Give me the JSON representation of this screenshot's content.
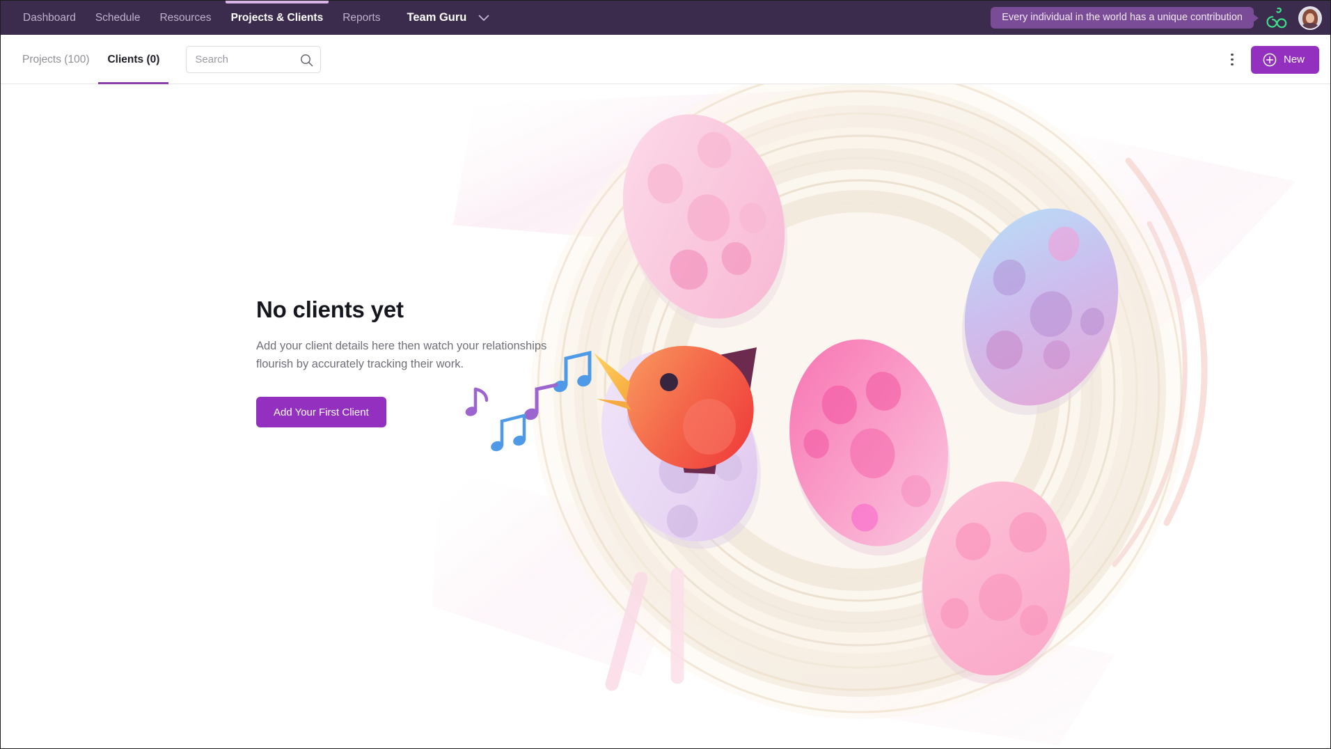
{
  "topnav": {
    "items": [
      {
        "label": "Dashboard",
        "active": false
      },
      {
        "label": "Schedule",
        "active": false
      },
      {
        "label": "Resources",
        "active": false
      },
      {
        "label": "Projects & Clients",
        "active": true
      },
      {
        "label": "Reports",
        "active": false
      }
    ],
    "team_name": "Team Guru",
    "team_chevron_icon": "chevron-down-icon",
    "tooltip_text": "Every individual in the world has a unique contribution",
    "logo_icon": "infinity-mascot-icon",
    "logo_color": "#3fe08a",
    "avatar_icon": "user-avatar",
    "background_color": "#3b2b4d",
    "active_indicator_color": "#d7b3e8"
  },
  "toolbar": {
    "tabs": [
      {
        "label": "Projects (100)",
        "active": false
      },
      {
        "label": "Clients (0)",
        "active": true
      }
    ],
    "search": {
      "placeholder": "Search",
      "value": "",
      "icon": "search-icon"
    },
    "more_menu_icon": "kebab-menu-icon",
    "new_button": {
      "label": "New",
      "icon": "plus-circle-icon",
      "color": "#9430bf"
    },
    "active_tab_underline_color": "#8b3fa8"
  },
  "empty_state": {
    "title": "No clients yet",
    "description": "Add your client details here then watch your relationships flourish by accurately tracking their work.",
    "cta_label": "Add Your First Client",
    "cta_color": "#9430bf"
  },
  "illustration": {
    "name": "bird-nest-with-eggs-illustration",
    "nest_color": "#f6efe6",
    "eggs": [
      {
        "name": "egg-pink-top-left",
        "color": "#f9c4da"
      },
      {
        "name": "egg-blue-purple-right",
        "color": "#c9b6e8"
      },
      {
        "name": "egg-hot-pink-center",
        "color": "#f78cbe"
      },
      {
        "name": "egg-pale-pink-bottom",
        "color": "#fbb6ce"
      },
      {
        "name": "egg-lavender-with-bird",
        "color": "#e5d5f2"
      }
    ],
    "bird": {
      "name": "singing-bird",
      "body_color": "#f4553f",
      "beak_color": "#ffc94d",
      "wing_color": "#6b2a4e"
    },
    "music_notes": [
      {
        "name": "music-note-blue",
        "color": "#4e9ae6"
      },
      {
        "name": "music-note-purple",
        "color": "#9b64cf"
      },
      {
        "name": "music-note-blue-small",
        "color": "#4e9ae6"
      },
      {
        "name": "music-note-purple-small",
        "color": "#9b64cf"
      }
    ]
  }
}
